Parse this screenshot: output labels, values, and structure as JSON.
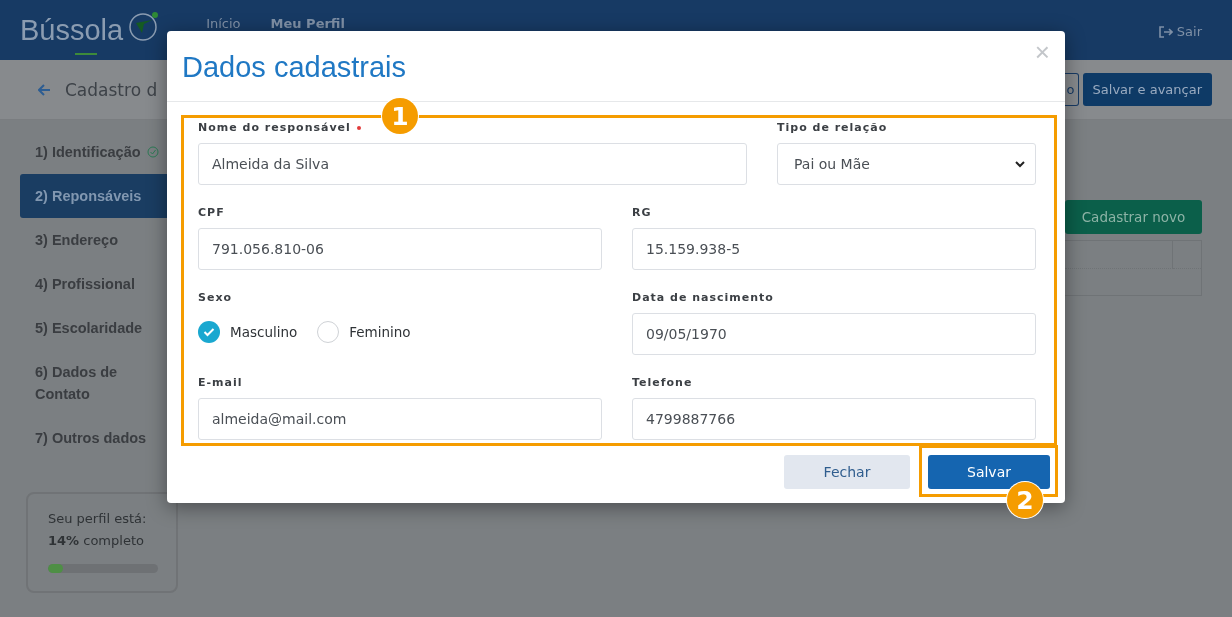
{
  "header": {
    "logo": "Bússola",
    "nav": [
      {
        "label": "Início",
        "selected": false
      },
      {
        "label": "Meu Perfil",
        "selected": true
      }
    ],
    "logout": "Sair"
  },
  "subheader": {
    "title": "Cadastro d",
    "buttons": [
      {
        "label": "o",
        "kind": "outline"
      },
      {
        "label": "Salvar e avançar",
        "kind": "primary"
      }
    ]
  },
  "sidebar": {
    "items": [
      {
        "label": "1) Identificação",
        "selected": false,
        "done": true
      },
      {
        "label": "2) Reponsáveis",
        "selected": true,
        "done": false
      },
      {
        "label": "3) Endereço",
        "selected": false,
        "done": false
      },
      {
        "label": "4) Profissional",
        "selected": false,
        "done": false
      },
      {
        "label": "5) Escolaridade",
        "selected": false,
        "done": false
      },
      {
        "label": "6) Dados de Contato",
        "selected": false,
        "done": false
      },
      {
        "label": "7) Outros dados",
        "selected": false,
        "done": false
      }
    ],
    "progress": {
      "heading": "Seu perfil está:",
      "summary": "**14%** completo",
      "level": 0.14
    }
  },
  "main": {
    "add_button": "Cadastrar novo"
  },
  "modal": {
    "title": "Dados cadastrais",
    "close": "×",
    "rows": [
      [
        {
          "kind": "text",
          "label": "Nome do responsável",
          "required": true,
          "value": "Almeida da Silva"
        },
        {
          "kind": "select",
          "label": "Tipo de relação",
          "required": false,
          "value": "Pai ou Mãe"
        }
      ],
      [
        {
          "kind": "text",
          "label": "CPF",
          "required": false,
          "value": "791.056.810-06"
        },
        {
          "kind": "text",
          "label": "RG",
          "required": false,
          "value": "15.159.938-5"
        }
      ],
      [
        {
          "kind": "radio",
          "label": "Sexo",
          "required": false,
          "options": [
            {
              "label": "Masculino",
              "selected": true
            },
            {
              "label": "Feminino",
              "selected": false
            }
          ]
        },
        {
          "kind": "text",
          "label": "Data de nascimento",
          "required": false,
          "value": "09/05/1970"
        }
      ],
      [
        {
          "kind": "text",
          "label": "E-mail",
          "required": false,
          "value": "almeida@mail.com"
        },
        {
          "kind": "text",
          "label": "Telefone",
          "required": false,
          "value": "4799887766"
        }
      ]
    ],
    "buttons": [
      {
        "label": "Fechar",
        "kind": "secondary"
      },
      {
        "label": "Salvar",
        "kind": "primary"
      }
    ]
  },
  "annotations": [
    "1",
    "2"
  ]
}
